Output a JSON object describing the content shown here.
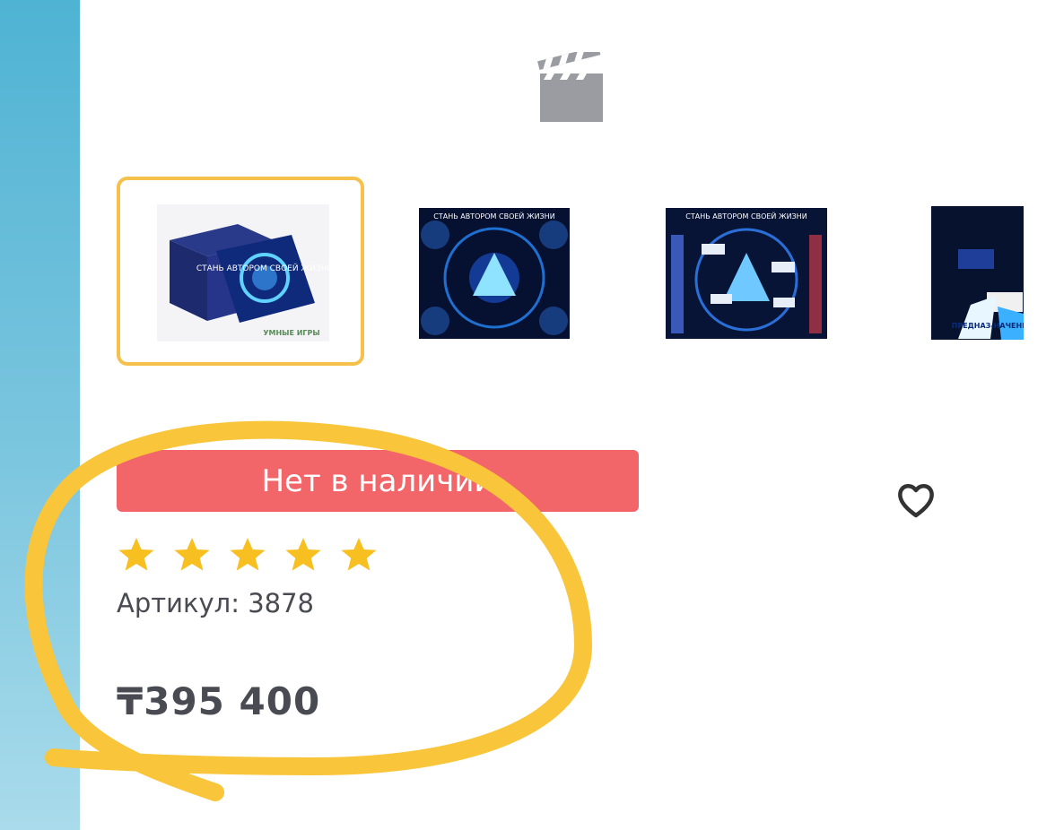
{
  "media": {
    "video_icon": "film-clapper-icon",
    "thumbnails": [
      {
        "name": "thumbnail-1",
        "selected": true,
        "box_text": "СТАНЬ АВТОРОМ СВОЕЙ ЖИЗНИ",
        "brand": "УМНЫЕ ИГРЫ"
      },
      {
        "name": "thumbnail-2",
        "selected": false,
        "box_text": "СТАНЬ АВТОРОМ СВОЕЙ ЖИЗНИ"
      },
      {
        "name": "thumbnail-3",
        "selected": false,
        "box_text": "СТАНЬ АВТОРОМ СВОЕЙ ЖИЗНИ"
      },
      {
        "name": "thumbnail-4",
        "selected": false,
        "box_text": "ПРЕДНАЗ-НАЧЕНИЕ"
      }
    ]
  },
  "product": {
    "stock_label": "Нет в наличии",
    "rating": 5,
    "sku_label": "Артикул: 3878",
    "price": "₸395 400"
  },
  "icons": {
    "wishlist": "heart-icon",
    "rating": "star-icon"
  },
  "colors": {
    "accent_border": "#f6c04d",
    "out_of_stock": "#f2666a",
    "star": "#f8bf21",
    "text": "#4a4a52",
    "scribble": "#f9c53a"
  }
}
